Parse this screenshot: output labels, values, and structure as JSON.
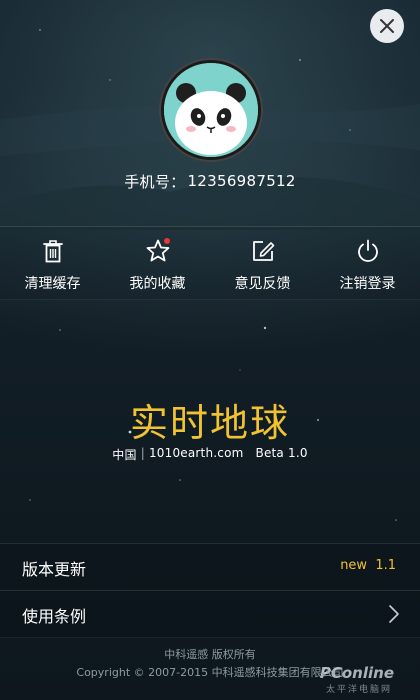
{
  "header": {
    "close_icon": "close-icon"
  },
  "profile": {
    "avatar_icon": "panda-avatar",
    "phone_label": "手机号：",
    "phone_number": "12356987512"
  },
  "actions": [
    {
      "icon": "trash-icon",
      "label": "清理缓存"
    },
    {
      "icon": "star-icon",
      "label": "我的收藏",
      "badge": true
    },
    {
      "icon": "edit-icon",
      "label": "意见反馈"
    },
    {
      "icon": "power-icon",
      "label": "注销登录"
    }
  ],
  "logo": {
    "title": "实时地球",
    "country": "中国",
    "site": "1010earth.com",
    "version": "Beta 1.0"
  },
  "menu": {
    "update_label": "版本更新",
    "update_badge": "new  1.1",
    "terms_label": "使用条例"
  },
  "footer": {
    "line1": "中科遥感 版权所有",
    "line2": "Copyright © 2007-2015 中科遥感科技集团有限公司"
  },
  "watermark": {
    "main": "PConline",
    "sub": "太平洋电脑网"
  },
  "colors": {
    "accent": "#f1c231",
    "background": "#14212b",
    "badge": "#e53935"
  }
}
